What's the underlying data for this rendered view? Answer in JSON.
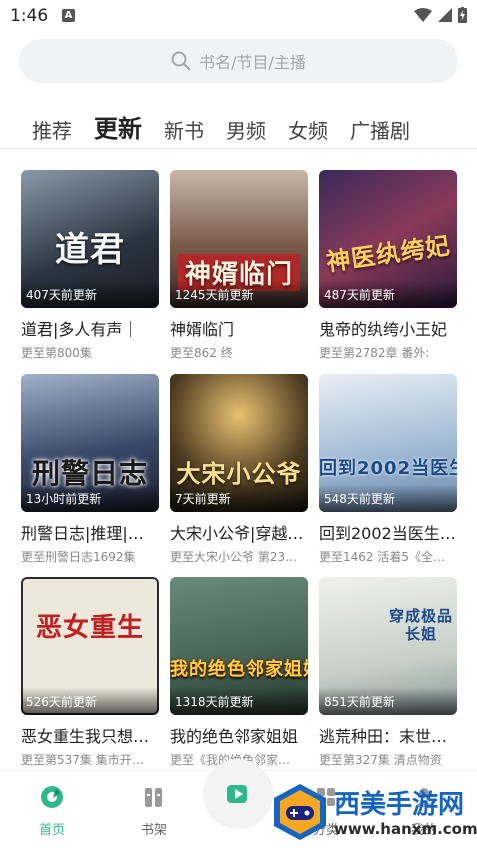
{
  "status": {
    "time": "1:46",
    "notif_letter": "A"
  },
  "search": {
    "placeholder": "书名/节目/主播"
  },
  "tabs": [
    {
      "label": "推荐",
      "active": false
    },
    {
      "label": "更新",
      "active": true
    },
    {
      "label": "新书",
      "active": false
    },
    {
      "label": "男频",
      "active": false
    },
    {
      "label": "女频",
      "active": false
    },
    {
      "label": "广播剧",
      "active": false
    }
  ],
  "books": [
    {
      "title": "道君|多人有声｜",
      "sub": "更至第800集",
      "update": "407天前更新",
      "cover_text": "道君",
      "cover_color": "#2a3440"
    },
    {
      "title": "神婿临门",
      "sub": "更至862 终",
      "update": "1245天前更新",
      "cover_text": "神婿临门",
      "cover_color": "#7a5a4a"
    },
    {
      "title": "鬼帝的纨绔小王妃",
      "sub": "更至第2782章 番外:",
      "update": "487天前更新",
      "cover_text": "神医纨绔妃",
      "cover_color": "#5a2a4a"
    },
    {
      "title": "刑警日志|推理|…",
      "sub": "更至刑警日志1692集",
      "update": "13小时前更新",
      "cover_text": "刑警日志",
      "cover_color": "#3a4a6a"
    },
    {
      "title": "大宋小公爷|穿越…",
      "sub": "更至大宋小公爷 第23…",
      "update": "7天前更新",
      "cover_text": "大宋小公爷",
      "cover_color": "#4a3a20"
    },
    {
      "title": "回到2002当医生…",
      "sub": "更至1462 活着5《全…",
      "update": "548天前更新",
      "cover_text": "回到2002当医生",
      "cover_color": "#6a8ab0"
    },
    {
      "title": "恶女重生我只想…",
      "sub": "更至第537集 集市开…",
      "update": "526天前更新",
      "cover_text": "恶女重生",
      "cover_color": "#e8e4d8"
    },
    {
      "title": "我的绝色邻家姐姐",
      "sub": "更至《我的绝色邻家…",
      "update": "1318天前更新",
      "cover_text": "我的绝色邻家姐姐",
      "cover_color": "#4a6a5a"
    },
    {
      "title": "逃荒种田：末世…",
      "sub": "更至第327集 清点物资",
      "update": "851天前更新",
      "cover_text": "穿成极品长姐",
      "cover_color": "#c8d0c8"
    }
  ],
  "nav": [
    {
      "label": "首页",
      "icon": "home-icon",
      "active": true
    },
    {
      "label": "书架",
      "icon": "bookshelf-icon",
      "active": false
    },
    {
      "label": "分类",
      "icon": "category-icon",
      "active": false
    },
    {
      "label": "我的",
      "icon": "profile-icon",
      "active": false
    }
  ],
  "watermark": {
    "text": "西美手游网",
    "url": "www.hanxm.com"
  },
  "colors": {
    "accent": "#2fb88b",
    "search_bg": "#f1f2f4"
  }
}
